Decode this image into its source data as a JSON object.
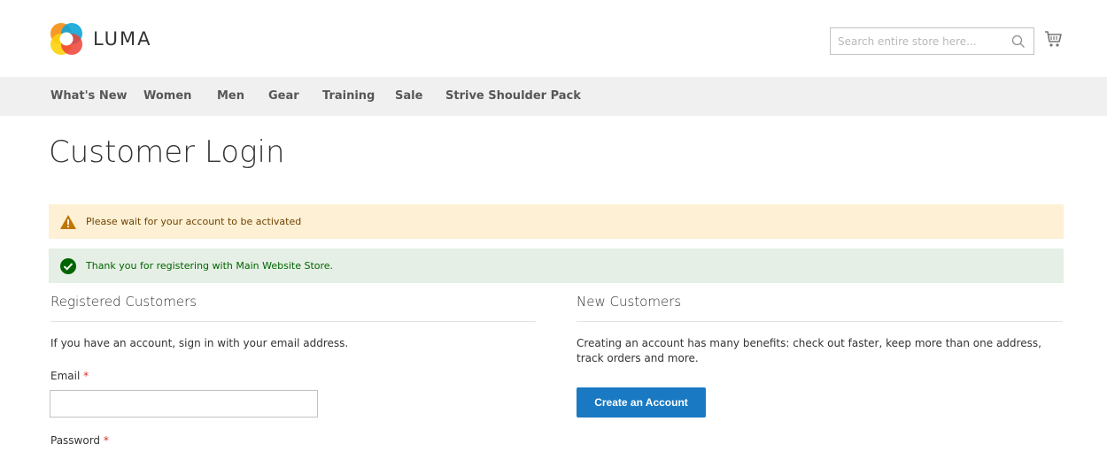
{
  "header": {
    "logo_text": "LUMA",
    "search_placeholder": "Search entire store here...",
    "search_icon": "search-icon",
    "cart_icon": "cart-icon"
  },
  "nav": {
    "items": [
      "What's New",
      "Women",
      "Men",
      "Gear",
      "Training",
      "Sale",
      "Strive Shoulder Pack"
    ]
  },
  "main": {
    "title": "Customer Login",
    "messages": {
      "warning": "Please wait for your account to be activated",
      "success": "Thank you for registering with Main Website Store."
    },
    "registered": {
      "title": "Registered Customers",
      "intro": "If you have an account, sign in with your email address.",
      "email_label": "Email",
      "password_label": "Password",
      "required_mark": "*",
      "email_value": ""
    },
    "new_customers": {
      "title": "New Customers",
      "description": "Creating an account has many benefits: check out faster, keep more than one address, track orders and more.",
      "button_label": "Create an Account"
    }
  },
  "colors": {
    "primary_button": "#1979c3",
    "nav_background": "#f0f0f0",
    "warning_background": "#fdf0d5",
    "success_background": "#e5efe5",
    "required": "#e02b27"
  }
}
